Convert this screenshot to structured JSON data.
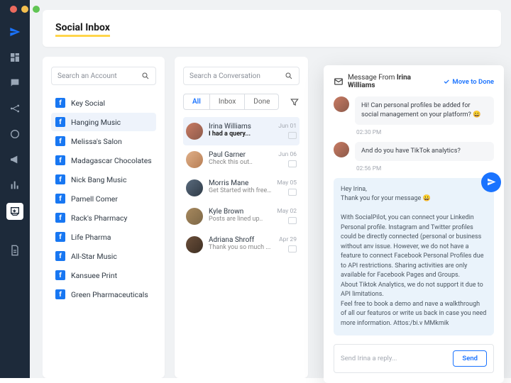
{
  "header": {
    "title": "Social Inbox"
  },
  "accounts": {
    "search_placeholder": "Search an Account",
    "items": [
      {
        "label": "Key Social"
      },
      {
        "label": "Hanging Music"
      },
      {
        "label": "Melissa's Salon"
      },
      {
        "label": "Madagascar Chocolates"
      },
      {
        "label": "Nick Bang Music"
      },
      {
        "label": "Pamell Comer"
      },
      {
        "label": "Rack's Pharmacy"
      },
      {
        "label": "Life Pharma"
      },
      {
        "label": "All-Star Music"
      },
      {
        "label": "Kansuee Print"
      },
      {
        "label": "Green Pharmaceuticals"
      }
    ]
  },
  "conversations": {
    "search_placeholder": "Search a Conversation",
    "tabs": {
      "all": "All",
      "inbox": "Inbox",
      "done": "Done"
    },
    "items": [
      {
        "name": "Irina Williams",
        "preview": "I had a query...",
        "date": "Jun 01"
      },
      {
        "name": "Paul Garner",
        "preview": "Check this out..",
        "date": "Jun 06"
      },
      {
        "name": "Morris Mane",
        "preview": "Get Started with free...",
        "date": "May 05"
      },
      {
        "name": "Kyle Brown",
        "preview": "Posts are lined up..",
        "date": "May 02"
      },
      {
        "name": "Adriana Shroff",
        "preview": "Thank you so much ...",
        "date": "Apr 29"
      }
    ]
  },
  "message": {
    "from_prefix": "Message From ",
    "from_name": "Irina Williams",
    "move_done": "Move to Done",
    "msg1": "Hi! Can personal profiles be added for social management on your platform? 😀",
    "ts1": "02:30 PM",
    "msg2": "And do you have TikTok analytics?",
    "ts2": "02:56 PM",
    "reply_greeting": "Hey Irina,",
    "reply_thanks": "Thank you for your message 😀",
    "reply_body": "With SocialPilot, you can connect your Linkedin Personal profile. Instagram and Twitter profiles could be directly connected (personal or business without anv issue. However, we do not have a feature to connect Facebook Personal Profiles due to API restrictions. Sharing activities are only available for Facebook Pages and Groups.\nAbout Tiktok Analytics, we do not support it due to API limitations.\nFeel free to book a demo and nave a walkthrough of all our featuros or write us back in case you need more information. Attos:/bi.v MMkmik",
    "reply_placeholder": "Send Irina a reply...",
    "send": "Send"
  }
}
